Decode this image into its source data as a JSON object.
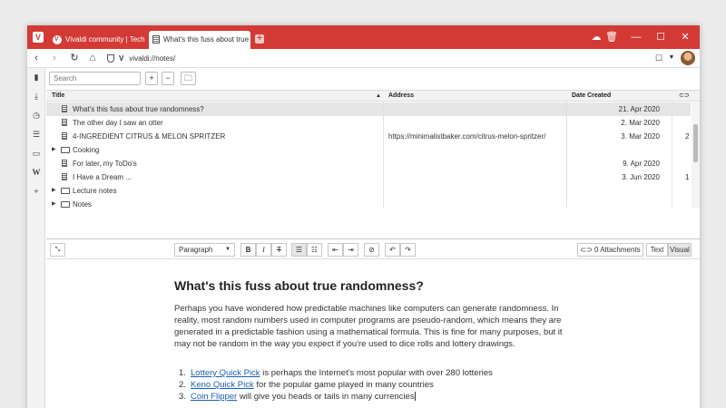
{
  "browser": {
    "tabs": [
      {
        "title": "Vivaldi community | Tech fo",
        "icon": "vivaldi-community-icon",
        "active": false
      },
      {
        "title": "What's this fuss about true",
        "icon": "notes-icon",
        "active": true
      }
    ],
    "address": "vivaldi://notes/",
    "accent_color": "#d33a36"
  },
  "panel": {
    "icons": [
      "bookmarks-icon",
      "downloads-icon",
      "history-icon",
      "notes-icon",
      "window-icon",
      "wikipedia-icon",
      "add-panel-icon"
    ]
  },
  "notes": {
    "search_placeholder": "Search",
    "columns": {
      "title": "Title",
      "address": "Address",
      "date": "Date Created"
    },
    "rows": [
      {
        "type": "note",
        "title": "What's this fuss about true randomness?",
        "address": "",
        "date": "21. Apr 2020",
        "att": "",
        "selected": true
      },
      {
        "type": "note",
        "title": "The other day I saw an otter",
        "address": "",
        "date": "2. Mar 2020",
        "att": ""
      },
      {
        "type": "note",
        "title": "4-INGREDIENT CITRUS & MELON SPRITZER",
        "address": "https://minimalistbaker.com/citrus-melon-spritzer/",
        "date": "3. Mar 2020",
        "att": "2"
      },
      {
        "type": "folder",
        "title": "Cooking",
        "address": "",
        "date": "",
        "att": ""
      },
      {
        "type": "note",
        "title": "For later, my ToDo's",
        "address": "",
        "date": "9. Apr 2020",
        "att": ""
      },
      {
        "type": "note",
        "title": "I Have a Dream ...",
        "address": "",
        "date": "3. Jun 2020",
        "att": "1"
      },
      {
        "type": "folder",
        "title": "Lecture notes",
        "address": "",
        "date": "",
        "att": ""
      },
      {
        "type": "folder",
        "title": "Notes",
        "address": "",
        "date": "",
        "att": ""
      }
    ]
  },
  "toolbar": {
    "paragraph_select": "Paragraph",
    "attachments": "0 Attachments",
    "mode_text": "Text",
    "mode_visual": "Visual"
  },
  "editor": {
    "heading": "What's this fuss about true randomness?",
    "paragraph": "Perhaps you have wondered how predictable machines like computers can generate randomness. In reality, most random numbers used in computer programs are pseudo-random, which means they are generated in a predictable fashion using a mathematical formula. This is fine for many purposes, but it may not be random in the way you expect if you're used to dice rolls and lottery drawings.",
    "list": [
      {
        "num": "1.",
        "link": "Lottery Quick Pick",
        "text": " is perhaps the Internet's most popular with over 280 lotteries"
      },
      {
        "num": "2.",
        "link": "Keno Quick Pick",
        "text": " for the popular game played in many countries"
      },
      {
        "num": "3.",
        "link": "Coin Flipper",
        "text": " will give you heads or tails in many currencies"
      }
    ]
  }
}
